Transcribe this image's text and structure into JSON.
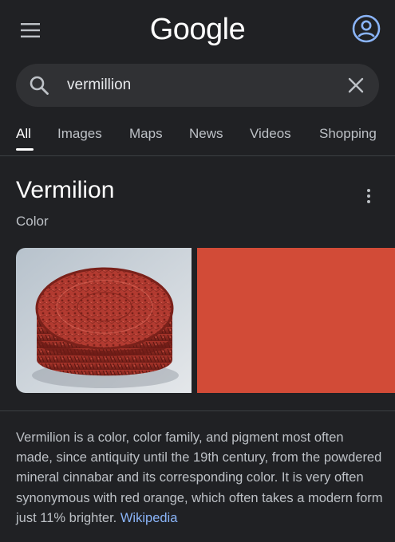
{
  "header": {
    "logo_text": "Google",
    "menu_icon": "hamburger-menu-icon",
    "account_icon": "account-circle-icon",
    "account_color": "#8ab4f8"
  },
  "search": {
    "query": "vermillion",
    "search_icon": "search-icon",
    "clear_icon": "close-icon"
  },
  "tabs": [
    {
      "label": "All",
      "active": true
    },
    {
      "label": "Images",
      "active": false
    },
    {
      "label": "Maps",
      "active": false
    },
    {
      "label": "News",
      "active": false
    },
    {
      "label": "Videos",
      "active": false
    },
    {
      "label": "Shopping",
      "active": false
    }
  ],
  "knowledge_panel": {
    "title": "Vermilion",
    "subtitle": "Color",
    "more_icon": "more-vert-icon",
    "image_subject": "carved cinnabar lacquer round box",
    "swatch_color": "#d24b37",
    "description": "Vermilion is a color, color family, and pigment most often made, since antiquity until the 19th century, from the powdered mineral cinnabar and its corresponding color. It is very often synonymous with red orange, which often takes a modern form just 11% brighter. ",
    "source_link": "Wikipedia"
  },
  "colors": {
    "background": "#202124",
    "searchbox": "#303134",
    "link": "#8ab4f8",
    "text_primary": "#ffffff",
    "text_secondary": "#bdc1c6"
  }
}
